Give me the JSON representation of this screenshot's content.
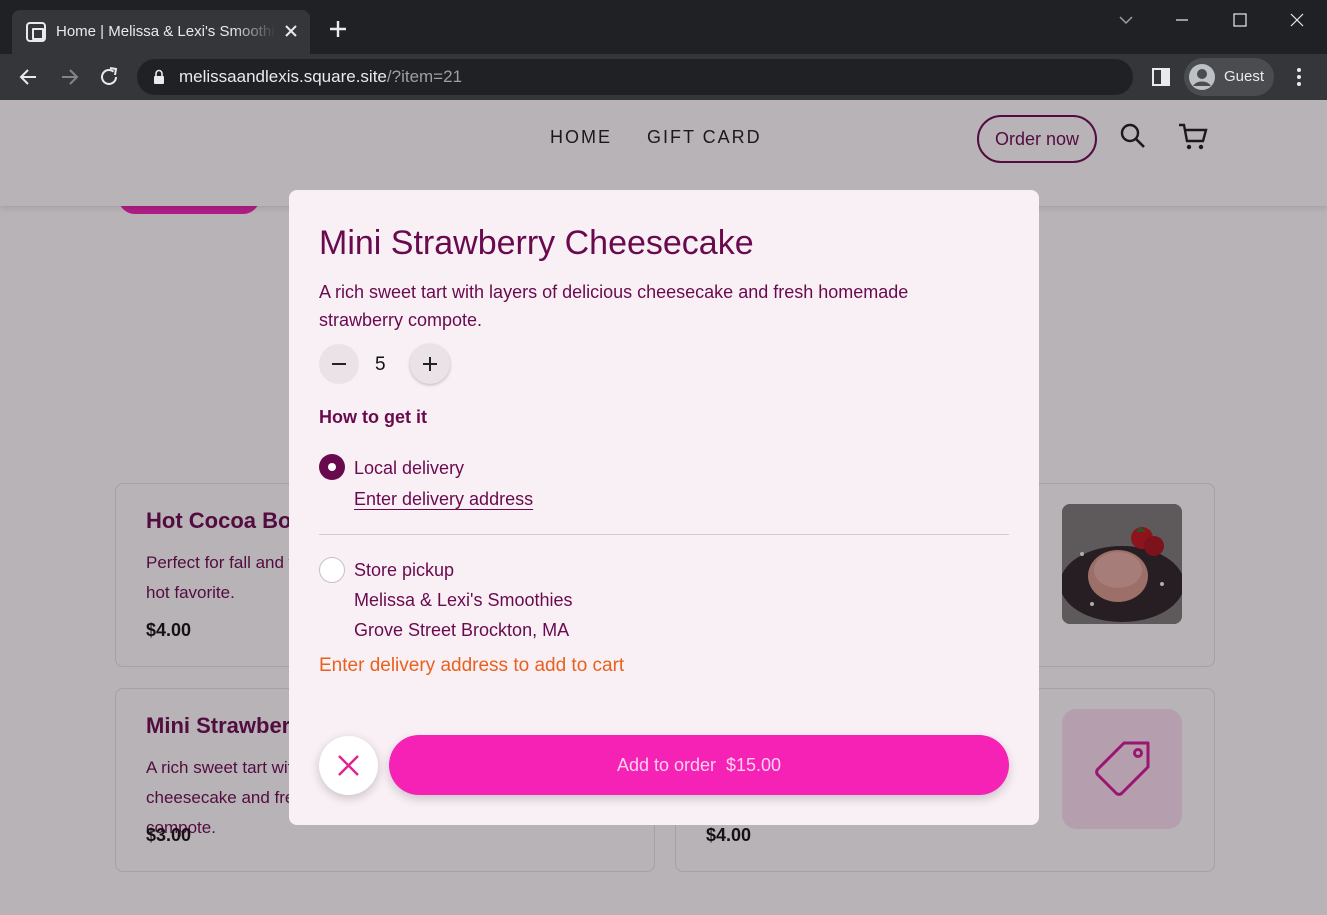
{
  "browser": {
    "tab_title": "Home | Melissa & Lexi's Smoothies",
    "url_host": "melissaandlexis.square.site",
    "url_path": "/?item=21",
    "profile_name": "Guest"
  },
  "header": {
    "nav": [
      "HOME",
      "GIFT CARD"
    ],
    "order_now": "Order now"
  },
  "cards": [
    {
      "title": "Hot Cocoa Bomb",
      "description": "Perfect for fall and winter, this cocoa bomb is a hot favorite.",
      "price": "$4.00"
    },
    {
      "title": "",
      "description": "",
      "price": ""
    },
    {
      "title": "Mini Strawberry Cheesecake",
      "description": "A rich sweet tart with layers of delicious cheesecake and fresh homemade strawberry compote.",
      "price": "$3.00"
    },
    {
      "title": "",
      "description": "",
      "price": "$4.00"
    }
  ],
  "modal": {
    "title": "Mini Strawberry Cheesecake",
    "description": "A rich sweet tart with layers of delicious cheesecake and fresh homemade strawberry compote.",
    "quantity": "5",
    "fulfillment_label": "How to get it",
    "local_delivery": "Local delivery",
    "enter_address_link": "Enter delivery address",
    "store_pickup": "Store pickup",
    "store_name": "Melissa & Lexi's Smoothies",
    "store_address": "Grove Street Brockton, MA",
    "error": "Enter delivery address to add to cart",
    "add_button": "Add to order  $15.00"
  },
  "colors": {
    "brand_plum": "#6a0a4e",
    "accent_pink": "#f522b5",
    "error_orange": "#e8611e",
    "chrome_dark": "#202124"
  },
  "icons": [
    "square-logo-icon",
    "close-icon",
    "plus-icon",
    "chevron-down-icon",
    "minimize-icon",
    "maximize-icon",
    "back-arrow-icon",
    "forward-arrow-icon",
    "reload-icon",
    "lock-icon",
    "side-panel-icon",
    "avatar-icon",
    "kebab-menu-icon",
    "search-icon",
    "cart-icon",
    "tag-icon"
  ]
}
